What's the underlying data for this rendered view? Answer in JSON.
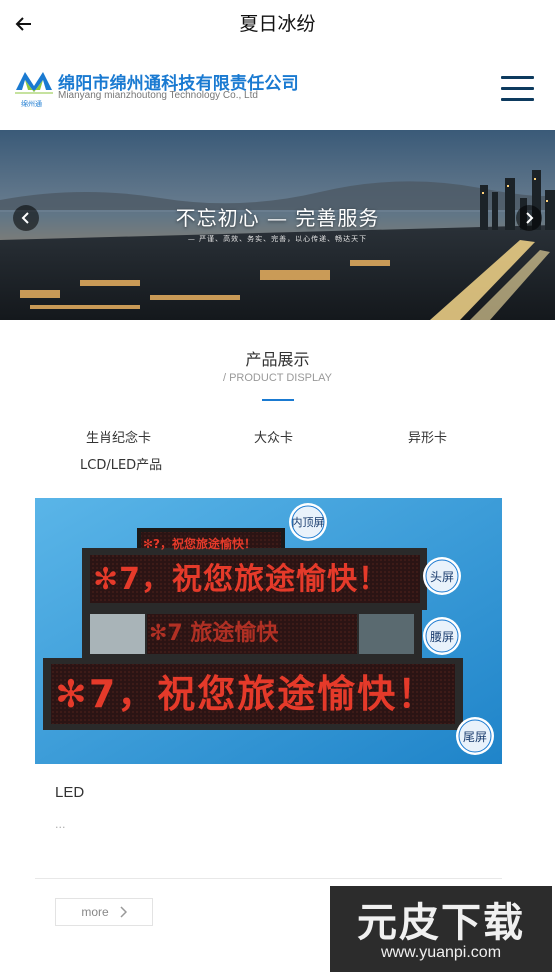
{
  "topbar": {
    "title": "夏日冰纷"
  },
  "company": {
    "name_cn": "绵阳市绵州通科技有限责任公司",
    "name_en": "Mianyang mianzhoutong Technology Co., Ltd",
    "logo_small": "绵州通"
  },
  "banner": {
    "headline": "不忘初心 — 完善服务",
    "subline": "— 严谨、高效、务实、完善，以心传递、畅达天下"
  },
  "section": {
    "title": "产品展示",
    "subtitle": "/ PRODUCT DISPLAY"
  },
  "categories": [
    "生肖纪念卡",
    "大众卡",
    "异形卡",
    "LCD/LED产品"
  ],
  "product": {
    "image_badges": [
      "内顶屏",
      "头屏",
      "腰屏",
      "尾屏"
    ],
    "screen_text": [
      "✻?，祝您旅途愉快！",
      "✻7，祝您旅途愉快！",
      "✻7 旅途愉快",
      "✻7，祝您旅途愉快！"
    ],
    "name": "LED",
    "description": "...",
    "more_label": "more"
  },
  "watermark": {
    "cn": "元皮下载",
    "url": "www.yuanpi.com"
  },
  "colors": {
    "brand_blue": "#1a7ad1",
    "menu_navy": "#0d3a5e",
    "led_red": "#e53a2a"
  }
}
